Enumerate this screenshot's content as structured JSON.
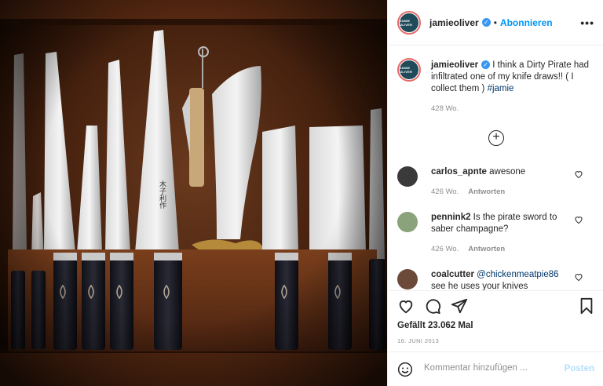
{
  "post": {
    "username": "jamieoliver",
    "follow_label": "Abonnieren",
    "dot": "•",
    "more_label": "•••",
    "avatar_text": "JAMIE OLIVER"
  },
  "caption": {
    "username": "jamieoliver",
    "text": " I think a Dirty Pirate had infiltrated one of my knife draws!! ( I collect them ) ",
    "hashtag": "#jamie",
    "time": "428 Wo."
  },
  "load_more_label": "+",
  "comments": [
    {
      "username": "carlos_apnte",
      "text": " awesone",
      "time": "426 Wo.",
      "reply": "Antworten",
      "avatar_color": "#3a3a3a"
    },
    {
      "username": "pennink2",
      "text": " Is the pirate sword to saber champagne?",
      "time": "426 Wo.",
      "reply": "Antworten",
      "avatar_color": "#8aa37a"
    },
    {
      "username": "coalcutter",
      "mention": "@chickenmeatpie86",
      "text": "see he uses your knives",
      "avatar_color": "#6b4a3a"
    }
  ],
  "likes": "Gefällt 23.062 Mal",
  "date": "16. JUNI 2013",
  "composer": {
    "placeholder": "Kommentar hinzufügen ...",
    "post_label": "Posten"
  },
  "colors": {
    "accent": "#0095f6",
    "verified": "#3897f0",
    "post_disabled": "#b2dffc"
  },
  "icons": [
    "verified-icon",
    "more-icon",
    "add-comment-icon",
    "heart-icon",
    "comment-icon",
    "share-icon",
    "bookmark-icon",
    "emoji-icon"
  ]
}
